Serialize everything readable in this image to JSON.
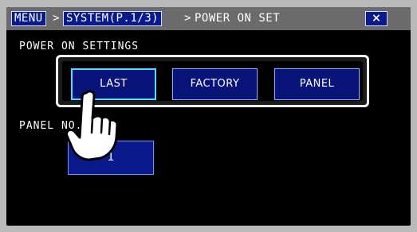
{
  "header": {
    "menu_label": "MENU",
    "sep1": ">",
    "system_label": "SYSTEM(P.1/3)",
    "sep2": ">",
    "page_title": "POWER ON SET",
    "close_label": "×"
  },
  "main": {
    "power_on_label": "POWER ON SETTINGS",
    "panel_no_label": "PANEL NO.",
    "panel_no_value": "1"
  },
  "popup": {
    "options": [
      "LAST",
      "FACTORY",
      "PANEL"
    ],
    "selected": "LAST"
  },
  "icons": {
    "pointer": "pointing-hand-icon"
  },
  "colors": {
    "button_fill": "#081479",
    "highlight": "#4fe0ff",
    "titlebar": "#6b6b6b"
  }
}
